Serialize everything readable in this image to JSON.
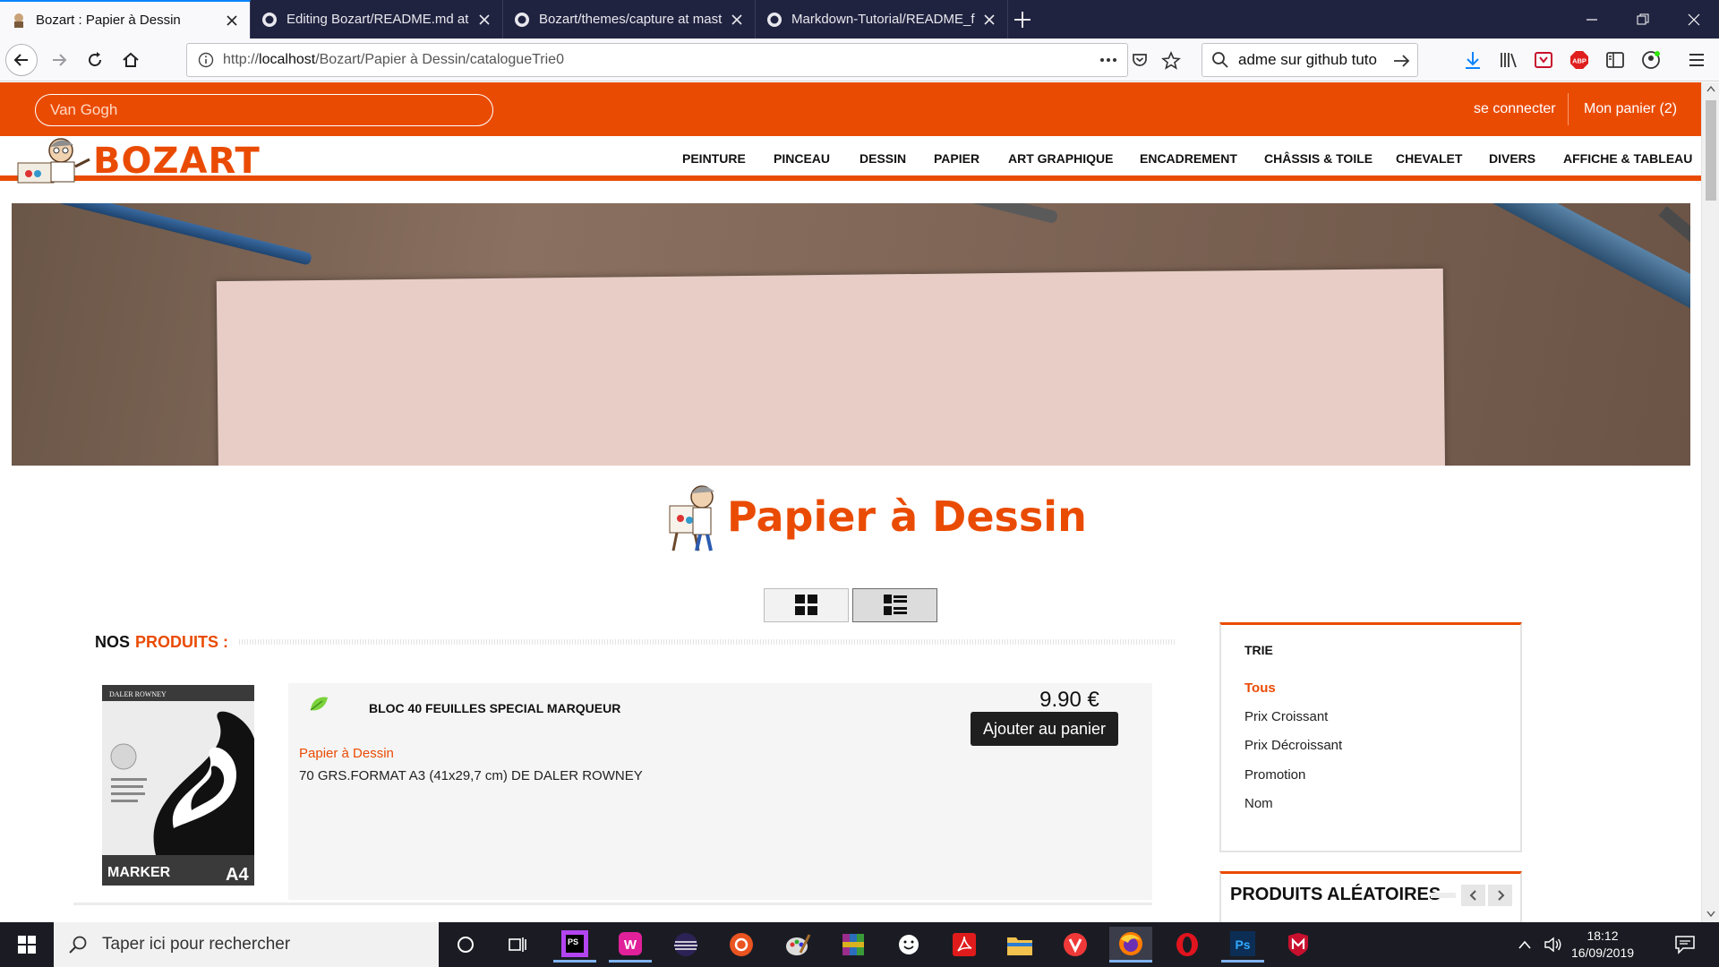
{
  "browser": {
    "tabs": [
      {
        "title": "Bozart : Papier à Dessin",
        "active": true
      },
      {
        "title": "Editing Bozart/README.md at",
        "active": false
      },
      {
        "title": "Bozart/themes/capture at mast",
        "active": false
      },
      {
        "title": "Markdown-Tutorial/README_f",
        "active": false
      }
    ],
    "url_prefix": "http://",
    "url_host": "localhost",
    "url_path": "/Bozart/Papier à Dessin/catalogueTrie0",
    "search_text": "adme sur github tuto"
  },
  "site": {
    "search_value": "Van Gogh",
    "login_link": "se connecter",
    "cart_link": "Mon panier (2)",
    "logo_text": "BOZART",
    "menu": [
      "PEINTURE",
      "PINCEAU",
      "DESSIN",
      "PAPIER",
      "ART GRAPHIQUE",
      "ENCADREMENT",
      "CHÂSSIS & TOILE",
      "CHEVALET",
      "DIVERS",
      "AFFICHE & TABLEAU"
    ],
    "category_title": "Papier à Dessin",
    "products_heading": {
      "prefix": "NOS",
      "highlight": "PRODUITS :"
    },
    "product": {
      "name": "BLOC 40 FEUILLES SPECIAL MARQUEUR",
      "category": "Papier à Dessin",
      "description": "70 GRS.FORMAT A3 (41x29,7 cm) DE DALER ROWNEY",
      "price": "9.90 €",
      "add_button": "Ajouter au panier",
      "image_brand": "DALER ROWNEY",
      "image_label": "MARKER",
      "image_size": "A4"
    },
    "sort": {
      "title": "TRIE",
      "options": [
        "Tous",
        "Prix Croissant",
        "Prix Décroissant",
        "Promotion",
        "Nom"
      ],
      "selected": "Tous"
    },
    "random_products_title": "PRODUITS ALÉATOIRES"
  },
  "taskbar": {
    "search_placeholder": "Taper ici pour rechercher",
    "time": "18:12",
    "date": "16/09/2019"
  },
  "colors": {
    "brand": "#ea4b03",
    "tabbar": "#202340",
    "taskbar": "#1b1c23"
  }
}
